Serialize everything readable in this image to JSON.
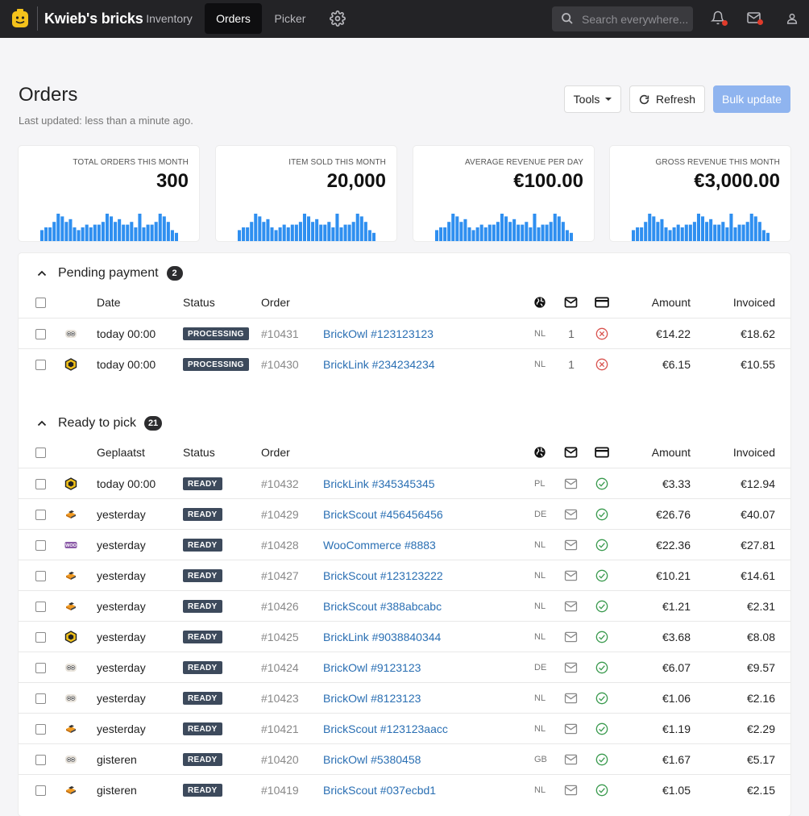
{
  "nav": {
    "brand": "Kwieb's bricks",
    "links": [
      {
        "label": "Inventory",
        "active": false
      },
      {
        "label": "Orders",
        "active": true
      },
      {
        "label": "Picker",
        "active": false
      }
    ],
    "search_placeholder": "Search everywhere..."
  },
  "header": {
    "title": "Orders",
    "subtitle": "Last updated: less than a minute ago.",
    "tools_label": "Tools",
    "refresh_label": "Refresh",
    "bulk_label": "Bulk update"
  },
  "stats": [
    {
      "label": "Total orders this month",
      "value": "300"
    },
    {
      "label": "Item sold this month",
      "value": "20,000"
    },
    {
      "label": "Average revenue per day",
      "value": "€100.00"
    },
    {
      "label": "Gross revenue this month",
      "value": "€3,000.00"
    }
  ],
  "sparkline": [
    0.4,
    0.5,
    0.5,
    0.7,
    1.0,
    0.9,
    0.7,
    0.8,
    0.5,
    0.4,
    0.5,
    0.6,
    0.5,
    0.6,
    0.6,
    0.7,
    1.0,
    0.9,
    0.7,
    0.8,
    0.6,
    0.6,
    0.7,
    0.5,
    1.0,
    0.5,
    0.6,
    0.6,
    0.7,
    1.0,
    0.9,
    0.7,
    0.4,
    0.3
  ],
  "pending": {
    "title": "Pending payment",
    "count": "2",
    "columns": {
      "date": "Date",
      "status": "Status",
      "order": "Order",
      "amount": "Amount",
      "invoiced": "Invoiced"
    },
    "rows": [
      {
        "source": "brickowl",
        "date": "today 00:00",
        "status": "PROCESSING",
        "order_no": "#10431",
        "ref": "BrickOwl #123123123",
        "country": "NL",
        "messages": "1",
        "paid": false,
        "amount": "€14.22",
        "invoiced": "€18.62"
      },
      {
        "source": "bricklink",
        "date": "today 00:00",
        "status": "PROCESSING",
        "order_no": "#10430",
        "ref": "BrickLink #234234234",
        "country": "NL",
        "messages": "1",
        "paid": false,
        "amount": "€6.15",
        "invoiced": "€10.55"
      }
    ]
  },
  "ready": {
    "title": "Ready to pick",
    "count": "21",
    "columns": {
      "date": "Geplaatst",
      "status": "Status",
      "order": "Order",
      "amount": "Amount",
      "invoiced": "Invoiced"
    },
    "rows": [
      {
        "source": "bricklink",
        "date": "today 00:00",
        "status": "READY",
        "order_no": "#10432",
        "ref": "BrickLink #345345345",
        "country": "PL",
        "paid": true,
        "amount": "€3.33",
        "invoiced": "€12.94"
      },
      {
        "source": "brickscout",
        "date": "yesterday",
        "status": "READY",
        "order_no": "#10429",
        "ref": "BrickScout #456456456",
        "country": "DE",
        "paid": true,
        "amount": "€26.76",
        "invoiced": "€40.07"
      },
      {
        "source": "woocommerce",
        "date": "yesterday",
        "status": "READY",
        "order_no": "#10428",
        "ref": "WooCommerce #8883",
        "country": "NL",
        "paid": true,
        "amount": "€22.36",
        "invoiced": "€27.81"
      },
      {
        "source": "brickscout",
        "date": "yesterday",
        "status": "READY",
        "order_no": "#10427",
        "ref": "BrickScout #123123222",
        "country": "NL",
        "paid": true,
        "amount": "€10.21",
        "invoiced": "€14.61"
      },
      {
        "source": "brickscout",
        "date": "yesterday",
        "status": "READY",
        "order_no": "#10426",
        "ref": "BrickScout #388abcabc",
        "country": "NL",
        "paid": true,
        "amount": "€1.21",
        "invoiced": "€2.31"
      },
      {
        "source": "bricklink",
        "date": "yesterday",
        "status": "READY",
        "order_no": "#10425",
        "ref": "BrickLink #9038840344",
        "country": "NL",
        "paid": true,
        "amount": "€3.68",
        "invoiced": "€8.08"
      },
      {
        "source": "brickowl",
        "date": "yesterday",
        "status": "READY",
        "order_no": "#10424",
        "ref": "BrickOwl #9123123",
        "country": "DE",
        "paid": true,
        "amount": "€6.07",
        "invoiced": "€9.57"
      },
      {
        "source": "brickowl",
        "date": "yesterday",
        "status": "READY",
        "order_no": "#10423",
        "ref": "BrickOwl #8123123",
        "country": "NL",
        "paid": true,
        "amount": "€1.06",
        "invoiced": "€2.16"
      },
      {
        "source": "brickscout",
        "date": "yesterday",
        "status": "READY",
        "order_no": "#10421",
        "ref": "BrickScout #123123aacc",
        "country": "NL",
        "paid": true,
        "amount": "€1.19",
        "invoiced": "€2.29"
      },
      {
        "source": "brickowl",
        "date": "gisteren",
        "status": "READY",
        "order_no": "#10420",
        "ref": "BrickOwl #5380458",
        "country": "GB",
        "paid": true,
        "amount": "€1.67",
        "invoiced": "€5.17"
      },
      {
        "source": "brickscout",
        "date": "gisteren",
        "status": "READY",
        "order_no": "#10419",
        "ref": "BrickScout #037ecbd1",
        "country": "NL",
        "paid": true,
        "amount": "€1.05",
        "invoiced": "€2.15"
      }
    ]
  },
  "colors": {
    "nav_bg": "#232326",
    "accent_blue": "#2a6fb3",
    "spark_blue": "#2f8ff0",
    "status_bg": "#3d4a5c",
    "error_red": "#d9534f",
    "success_green": "#3a9a4e"
  }
}
